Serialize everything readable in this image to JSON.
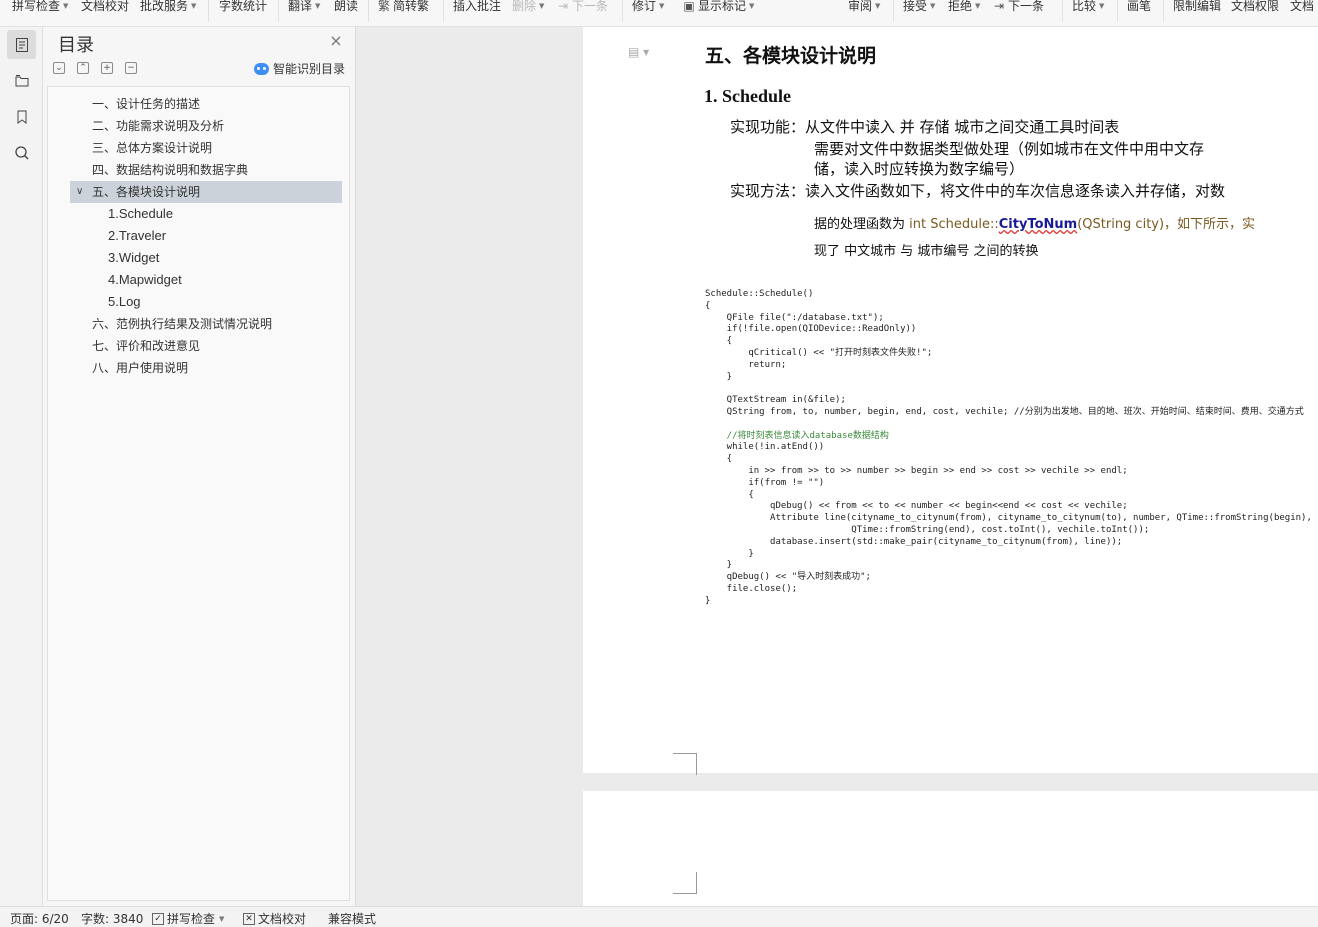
{
  "toolbar": {
    "items": [
      {
        "label": "拼写检查",
        "caret": true
      },
      {
        "label": "文档校对",
        "caret": false
      },
      {
        "label": "批改服务",
        "caret": true
      },
      {
        "label": "字数统计",
        "caret": false
      },
      {
        "label": "翻译",
        "caret": true
      },
      {
        "label": "朗读",
        "caret": false
      },
      {
        "label": "简转繁",
        "caret": false
      },
      {
        "label": "插入批注",
        "caret": false
      },
      {
        "label": "删除",
        "caret": true
      },
      {
        "label": "下一条",
        "caret": false
      },
      {
        "label": "修订",
        "caret": true
      },
      {
        "label": "显示标记",
        "caret": true
      },
      {
        "label": "审阅",
        "caret": true
      },
      {
        "label": "接受",
        "caret": true
      },
      {
        "label": "拒绝",
        "caret": true
      },
      {
        "label": "下一条",
        "caret": false
      },
      {
        "label": "比较",
        "caret": true
      },
      {
        "label": "画笔",
        "caret": false
      },
      {
        "label": "限制编辑",
        "caret": false
      },
      {
        "label": "文档权限",
        "caret": false
      },
      {
        "label": "文档",
        "caret": false
      }
    ]
  },
  "toc": {
    "title": "目录",
    "smart_label": "智能识别目录",
    "items": [
      {
        "label": "一、设计任务的描述",
        "level": 1,
        "selected": false
      },
      {
        "label": "二、功能需求说明及分析",
        "level": 1,
        "selected": false
      },
      {
        "label": "三、总体方案设计说明",
        "level": 1,
        "selected": false
      },
      {
        "label": "四、数据结构说明和数据字典",
        "level": 1,
        "selected": false
      },
      {
        "label": "五、各模块设计说明",
        "level": 1,
        "selected": true
      },
      {
        "label": "1.Schedule",
        "level": 2,
        "selected": false
      },
      {
        "label": "2.Traveler",
        "level": 2,
        "selected": false
      },
      {
        "label": "3.Widget",
        "level": 2,
        "selected": false
      },
      {
        "label": "4.Mapwidget",
        "level": 2,
        "selected": false
      },
      {
        "label": "5.Log",
        "level": 2,
        "selected": false
      },
      {
        "label": "六、范例执行结果及测试情况说明",
        "level": 1,
        "selected": false
      },
      {
        "label": "七、评价和改进意见",
        "level": 1,
        "selected": false
      },
      {
        "label": "八、用户使用说明",
        "level": 1,
        "selected": false
      }
    ]
  },
  "doc": {
    "heading": "五、各模块设计说明",
    "subheading": "1.  Schedule",
    "line1": "实现功能：从文件中读入 并 存储 城市之间交通工具时间表",
    "line2": "需要对文件中数据类型做处理（例如城市在文件中用中文存",
    "line3": "储，读入时应转换为数字编号）",
    "line4": "实现方法：读入文件函数如下，将文件中的车次信息逐条读入并存储，对数",
    "line5_a": "据的处理函数为",
    "line5_b": "int",
    "line5_c": "Schedule::",
    "line5_d": "CityToNum",
    "line5_e": "(QString city)，如下所示，实",
    "line6": "现了 中文城市 与 城市编号 之间的转换",
    "doc_tag": "▤ ▾"
  },
  "code_lines": [
    "Schedule::Schedule()",
    "{",
    "    QFile file(\":/database.txt\");",
    "    if(!file.open(QIODevice::ReadOnly))",
    "    {",
    "        qCritical() << \"打开时刻表文件失败!\";",
    "        return;",
    "    }",
    "",
    "    QTextStream in(&file);",
    "    QString from, to, number, begin, end, cost, vechile; //分别为出发地、目的地、班次、开始时间、结束时间、费用、交通方式",
    "",
    "    //将时刻表信息读入database数据结构",
    "    while(!in.atEnd())",
    "    {",
    "        in >> from >> to >> number >> begin >> end >> cost >> vechile >> endl;",
    "        if(from != \"\")",
    "        {",
    "            qDebug() << from << to << number << begin<<end << cost << vechile;",
    "            Attribute line(cityname_to_citynum(from), cityname_to_citynum(to), number, QTime::fromString(begin),",
    "                           QTime::fromString(end), cost.toInt(), vechile.toInt());",
    "            database.insert(std::make_pair(cityname_to_citynum(from), line));",
    "        }",
    "    }",
    "    qDebug() << \"导入时刻表成功\";",
    "    file.close();",
    "}"
  ],
  "status": {
    "page": "页面: 6/20",
    "words": "字数: 3840",
    "spell": "拼写检查",
    "proof": "文档校对",
    "compat": "兼容模式"
  }
}
